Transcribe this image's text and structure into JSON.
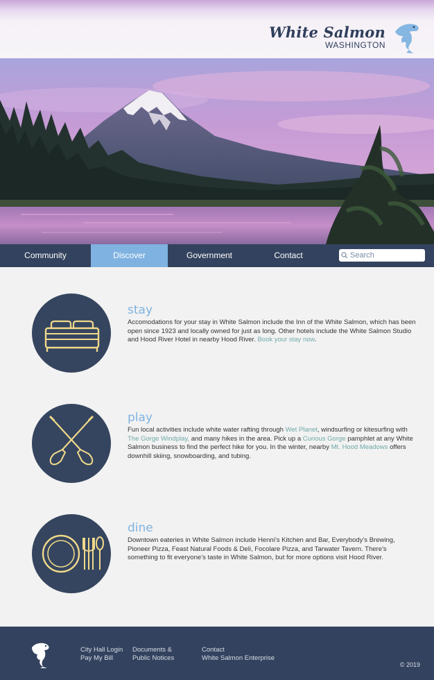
{
  "brand": {
    "name": "White Salmon",
    "subtitle": "WASHINGTON",
    "logo_icon": "salmon-fish-icon"
  },
  "nav": {
    "items": [
      {
        "label": "Community",
        "active": false
      },
      {
        "label": "Discover",
        "active": true
      },
      {
        "label": "Government",
        "active": false
      },
      {
        "label": "Contact",
        "active": false
      }
    ],
    "search_placeholder": "Search"
  },
  "sections": [
    {
      "title": "stay",
      "icon": "bed-icon",
      "body": [
        {
          "text": "Accomodations for your stay in White Salmon include the Inn of the White Salmon, which has been open since 1923 and locally owned for just as long. Other hotels include the White Salmon Studio and Hood River Hotel in nearby Hood River. "
        },
        {
          "text": "Book your stay now",
          "link": true
        },
        {
          "text": "."
        }
      ]
    },
    {
      "title": "play",
      "icon": "crossed-paddles-icon",
      "body": [
        {
          "text": "Fun local activities include white water rafting through "
        },
        {
          "text": "Wet Planet",
          "link": true
        },
        {
          "text": ", windsurfing or kitesurfing with "
        },
        {
          "text": "The Gorge Windplay,",
          "link": true
        },
        {
          "text": " and many hikes in the area. Pick up a "
        },
        {
          "text": "Curious Gorge",
          "link": true
        },
        {
          "text": " pamphlet at any White Salmon business to find the perfect hike for you. In the winter, nearby "
        },
        {
          "text": "Mt. Hood Meadows",
          "link": true
        },
        {
          "text": " offers downhill skiing, snowboarding, and tubing."
        }
      ]
    },
    {
      "title": "dine",
      "icon": "plate-fork-spoon-icon",
      "body": [
        {
          "text": "Downtown eateries in White Salmon include Henni’s Kitchen and Bar, Everybody’s Brewing, Pioneer Pizza, Feast Natural Foods & Deli, Focolare Pizza, and Tarwater Tavern. There’s something to fit everyone’s taste in White Salmon, but for more options visit Hood River."
        }
      ]
    }
  ],
  "footer": {
    "logo_icon": "salmon-fish-icon",
    "col1": [
      "City Hall Login",
      "Pay My Bill"
    ],
    "col2": [
      "Documents &",
      "Public Notices"
    ],
    "col3": [
      "Contact",
      "White Salmon Enterprise"
    ],
    "copyright": "© 2019"
  },
  "colors": {
    "navy": "#33425e",
    "accent_blue": "#7fb2e0",
    "link_teal": "#6fa8a8",
    "icon_gold": "#f0d98a",
    "fish_blue": "#86b6e2"
  }
}
